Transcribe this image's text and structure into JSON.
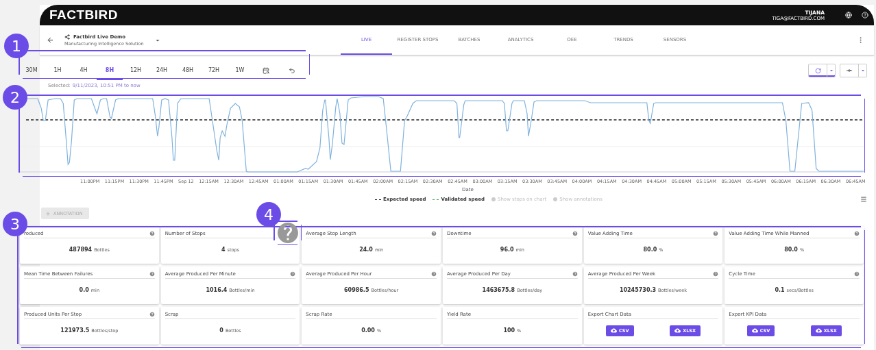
{
  "header": {
    "logo": "FACTBIRD",
    "user_name": "TIJANA",
    "user_email": "TIGA@FACTBIRD.COM"
  },
  "nav": {
    "site_title": "Factbird Live Demo",
    "site_subtitle": "Manufacturing Intelligence Solution",
    "tabs": [
      {
        "label": "LIVE",
        "selected": true
      },
      {
        "label": "REGISTER STOPS",
        "selected": false
      },
      {
        "label": "BATCHES",
        "selected": false
      },
      {
        "label": "ANALYTICS",
        "selected": false
      },
      {
        "label": "OEE",
        "selected": false
      },
      {
        "label": "TRENDS",
        "selected": false
      },
      {
        "label": "SENSORS",
        "selected": false
      }
    ]
  },
  "time_range": {
    "options": [
      {
        "label": "30M",
        "selected": false
      },
      {
        "label": "1H",
        "selected": false
      },
      {
        "label": "4H",
        "selected": false
      },
      {
        "label": "8H",
        "selected": true
      },
      {
        "label": "12H",
        "selected": false
      },
      {
        "label": "24H",
        "selected": false
      },
      {
        "label": "48H",
        "selected": false
      },
      {
        "label": "72H",
        "selected": false
      },
      {
        "label": "1W",
        "selected": false
      }
    ],
    "selected_label": "Selected:",
    "selected_value": "9/11/2023, 10:51 PM to now"
  },
  "toolbar": {
    "refresh_selected": true
  },
  "chart": {
    "x_title": "Date",
    "x_labels": [
      "11:00PM",
      "11:15PM",
      "11:30PM",
      "11:45PM",
      "Sep 12",
      "12:15AM",
      "12:30AM",
      "12:45AM",
      "01:00AM",
      "01:15AM",
      "01:30AM",
      "01:45AM",
      "02:00AM",
      "02:15AM",
      "02:30AM",
      "02:45AM",
      "03:00AM",
      "03:15AM",
      "03:30AM",
      "03:45AM",
      "04:00AM",
      "04:15AM",
      "04:30AM",
      "04:45AM",
      "05:00AM",
      "05:15AM",
      "05:30AM",
      "05:45AM",
      "06:00AM",
      "06:15AM",
      "06:30AM",
      "06:45AM"
    ],
    "legend": [
      {
        "kind": "series",
        "label": "Expected speed",
        "color": "#222222"
      },
      {
        "kind": "series",
        "label": "Validated speed",
        "color": "#3cb04a"
      },
      {
        "kind": "toggle",
        "label": "Show stops on chart",
        "on": false
      },
      {
        "kind": "toggle",
        "label": "Show annotations",
        "on": false
      }
    ]
  },
  "annotation_button": {
    "label": "ANNOTATION",
    "disabled": true
  },
  "kpis": [
    {
      "kind": "metric",
      "title": "roduced",
      "value": "487894",
      "unit": "Bottles",
      "help": true
    },
    {
      "kind": "metric",
      "title": "Number of Stops",
      "value": "4",
      "unit": "stops",
      "help": false
    },
    {
      "kind": "metric",
      "title": "Average Stop Length",
      "value": "24.0",
      "unit": "min",
      "help": true
    },
    {
      "kind": "metric",
      "title": "Downtime",
      "value": "96.0",
      "unit": "min",
      "help": true
    },
    {
      "kind": "metric",
      "title": "Value Adding Time",
      "value": "80.0",
      "unit": "%",
      "help": true
    },
    {
      "kind": "metric",
      "title": "Value Adding Time While Manned",
      "value": "80.0",
      "unit": "%",
      "help": true
    },
    {
      "kind": "metric",
      "title": "Mean Time Between Failures",
      "value": "0.0",
      "unit": "min",
      "help": true
    },
    {
      "kind": "metric",
      "title": "Average Produced Per Minute",
      "value": "1016.4",
      "unit": "Bottles/min",
      "help": true
    },
    {
      "kind": "metric",
      "title": "Average Produced Per Hour",
      "value": "60986.5",
      "unit": "Bottles/hour",
      "help": true
    },
    {
      "kind": "metric",
      "title": "Average Produced Per Day",
      "value": "1463675.8",
      "unit": "Bottles/day",
      "help": true
    },
    {
      "kind": "metric",
      "title": "Average Produced Per Week",
      "value": "10245730.3",
      "unit": "Bottles/week",
      "help": true
    },
    {
      "kind": "metric",
      "title": "Cycle Time",
      "value": "0.1",
      "unit": "secs/Bottles",
      "help": true
    },
    {
      "kind": "metric",
      "title": "Produced Units Per Stop",
      "value": "121973.5",
      "unit": "Bottles/stop",
      "help": true
    },
    {
      "kind": "metric",
      "title": "Scrap",
      "value": "0",
      "unit": "Bottles",
      "help": false
    },
    {
      "kind": "metric",
      "title": "Scrap Rate",
      "value": "0.00",
      "unit": "%",
      "help": false
    },
    {
      "kind": "metric",
      "title": "Yield Rate",
      "value": "100",
      "unit": "%",
      "help": false
    },
    {
      "kind": "export",
      "title": "Export Chart Data",
      "buttons": [
        "CSV",
        "XLSX"
      ]
    },
    {
      "kind": "export",
      "title": "Export KPI Data",
      "buttons": [
        "CSV",
        "XLSX"
      ]
    }
  ],
  "callouts": [
    "1",
    "2",
    "3",
    "4"
  ]
}
